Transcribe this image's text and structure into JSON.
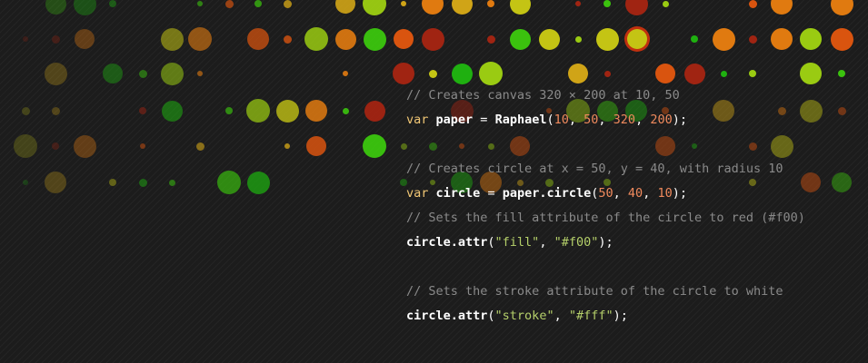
{
  "background": {
    "color": "#1c1c1c",
    "stripe_color": "#2a2a2a"
  },
  "colors": {
    "comment": "#8a8a8a",
    "keyword": "#f0c674",
    "identifier": "#ffffff",
    "number": "#f08a5d",
    "string": "#b5d06a",
    "dot_palette": [
      "#d9540f",
      "#e07a10",
      "#d0a417",
      "#c4c414",
      "#9acb12",
      "#3bc20e",
      "#1fb010",
      "#a02412"
    ]
  },
  "code_lines": [
    [
      {
        "type": "comment",
        "text": "// Creates canvas 320 × 200 at 10, 50"
      }
    ],
    [
      {
        "type": "kw",
        "text": "var"
      },
      {
        "type": "plain",
        "text": " "
      },
      {
        "type": "id",
        "text": "paper"
      },
      {
        "type": "plain",
        "text": " = "
      },
      {
        "type": "id",
        "text": "Raphael"
      },
      {
        "type": "plain",
        "text": "("
      },
      {
        "type": "num",
        "text": "10"
      },
      {
        "type": "plain",
        "text": ", "
      },
      {
        "type": "num",
        "text": "50"
      },
      {
        "type": "plain",
        "text": ", "
      },
      {
        "type": "num",
        "text": "320"
      },
      {
        "type": "plain",
        "text": ", "
      },
      {
        "type": "num",
        "text": "200"
      },
      {
        "type": "plain",
        "text": ");"
      }
    ],
    [],
    [
      {
        "type": "comment",
        "text": "// Creates circle at x = 50, y = 40, with radius 10"
      }
    ],
    [
      {
        "type": "kw",
        "text": "var"
      },
      {
        "type": "plain",
        "text": " "
      },
      {
        "type": "id",
        "text": "circle"
      },
      {
        "type": "plain",
        "text": " = "
      },
      {
        "type": "id",
        "text": "paper.circle"
      },
      {
        "type": "plain",
        "text": "("
      },
      {
        "type": "num",
        "text": "50"
      },
      {
        "type": "plain",
        "text": ", "
      },
      {
        "type": "num",
        "text": "40"
      },
      {
        "type": "plain",
        "text": ", "
      },
      {
        "type": "num",
        "text": "10"
      },
      {
        "type": "plain",
        "text": ");"
      }
    ],
    [
      {
        "type": "comment",
        "text": "// Sets the fill attribute of the circle to red (#f00)"
      }
    ],
    [
      {
        "type": "id",
        "text": "circle.attr"
      },
      {
        "type": "plain",
        "text": "("
      },
      {
        "type": "str",
        "text": "\"fill\""
      },
      {
        "type": "plain",
        "text": ", "
      },
      {
        "type": "str",
        "text": "\"#f00\""
      },
      {
        "type": "plain",
        "text": ");"
      }
    ],
    [],
    [
      {
        "type": "comment",
        "text": "// Sets the stroke attribute of the circle to white"
      }
    ],
    [
      {
        "type": "id",
        "text": "circle.attr"
      },
      {
        "type": "plain",
        "text": "("
      },
      {
        "type": "str",
        "text": "\"stroke\""
      },
      {
        "type": "plain",
        "text": ", "
      },
      {
        "type": "str",
        "text": "\"#fff\""
      },
      {
        "type": "plain",
        "text": ");"
      }
    ]
  ]
}
